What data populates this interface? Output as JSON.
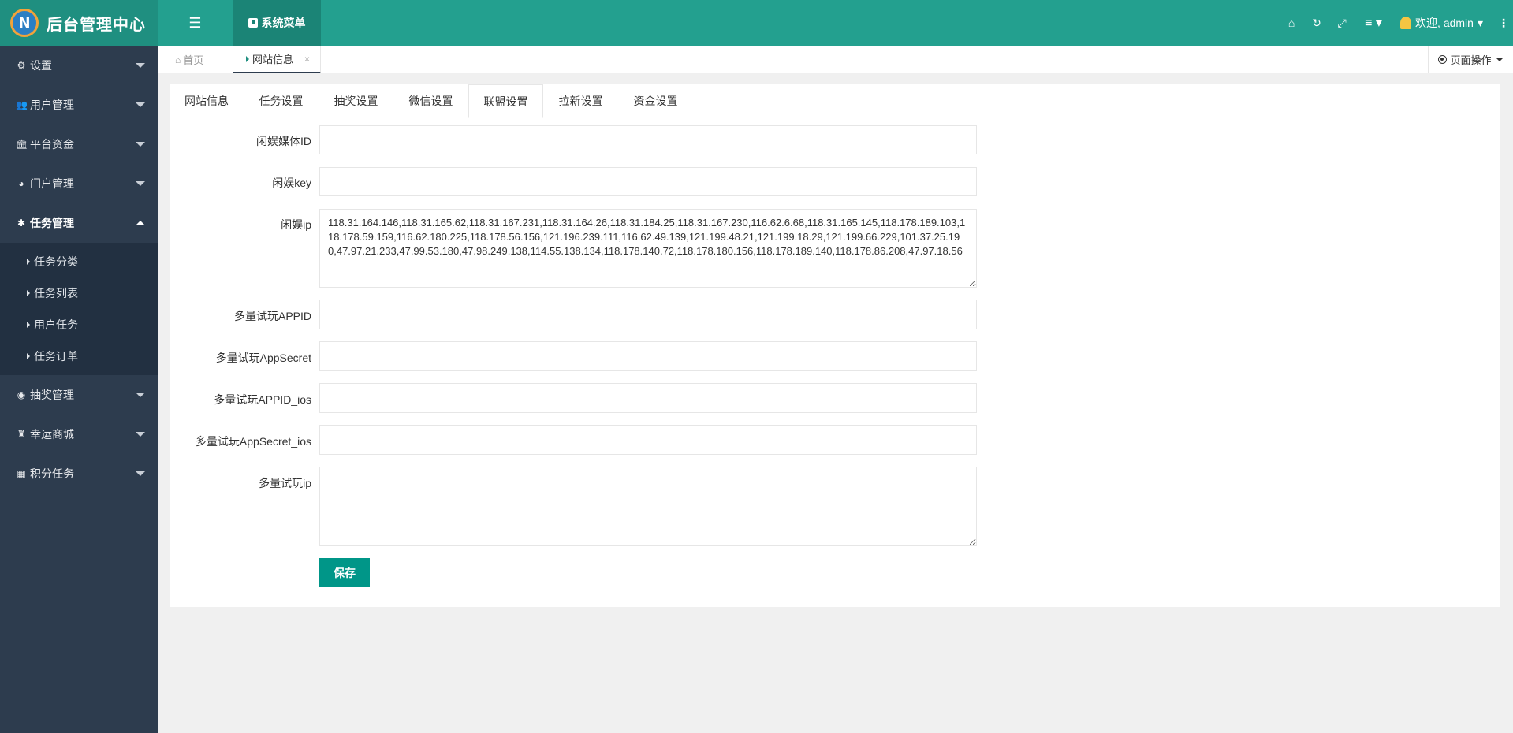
{
  "header": {
    "logo_mark": "N",
    "title": "后台管理中心",
    "toggle_icon": "list-indent-icon",
    "system_menu_label": "系统菜单",
    "welcome_text": "欢迎, admin"
  },
  "sidebar": {
    "items": [
      {
        "label": "设置",
        "icon": "cogs-icon"
      },
      {
        "label": "用户管理",
        "icon": "users-icon"
      },
      {
        "label": "平台资金",
        "icon": "bank-icon"
      },
      {
        "label": "门户管理",
        "icon": "globe-icon"
      },
      {
        "label": "任务管理",
        "icon": "bug-icon",
        "open": true
      },
      {
        "label": "抽奖管理",
        "icon": "compass-icon"
      },
      {
        "label": "幸运商城",
        "icon": "shop-icon"
      },
      {
        "label": "积分任务",
        "icon": "grid-icon"
      }
    ],
    "subitems": [
      "任务分类",
      "任务列表",
      "用户任务",
      "任务订单"
    ]
  },
  "tabbar": {
    "home_label": "首页",
    "active_tab_label": "网站信息",
    "close_glyph": "×",
    "page_ops_label": "页面操作"
  },
  "settings_tabs": [
    "网站信息",
    "任务设置",
    "抽奖设置",
    "微信设置",
    "联盟设置",
    "拉新设置",
    "资金设置"
  ],
  "active_settings_tab": "联盟设置",
  "form": {
    "xianyu_media_id": {
      "label": "闲娱媒体ID",
      "value": ""
    },
    "xianyu_key": {
      "label": "闲娱key",
      "value": ""
    },
    "xianyu_ip": {
      "label": "闲娱ip",
      "value": "118.31.164.146,118.31.165.62,118.31.167.231,118.31.164.26,118.31.184.25,118.31.167.230,116.62.6.68,118.31.165.145,118.178.189.103,118.178.59.159,116.62.180.225,118.178.56.156,121.196.239.111,116.62.49.139,121.199.48.21,121.199.18.29,121.199.66.229,101.37.25.190,47.97.21.233,47.99.53.180,47.98.249.138,114.55.138.134,118.178.140.72,118.178.180.156,118.178.189.140,118.178.86.208,47.97.18.56"
    },
    "duoliang_appid": {
      "label": "多量试玩APPID",
      "value": ""
    },
    "duoliang_appsecret": {
      "label": "多量试玩AppSecret",
      "value": ""
    },
    "duoliang_appid_ios": {
      "label": "多量试玩APPID_ios",
      "value": ""
    },
    "duoliang_appsecret_ios": {
      "label": "多量试玩AppSecret_ios",
      "value": ""
    },
    "duoliang_ip": {
      "label": "多量试玩ip",
      "value": ""
    },
    "save_label": "保存"
  },
  "colors": {
    "header_bg": "#23a08f",
    "sidebar_bg": "#2d3c4e",
    "primary_button": "#009688"
  }
}
